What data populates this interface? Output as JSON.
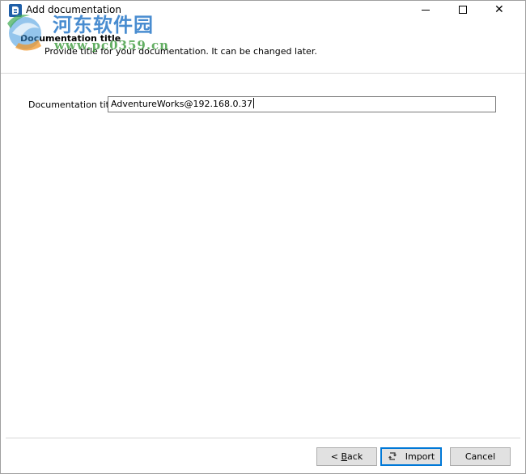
{
  "window": {
    "title": "Add documentation"
  },
  "watermark": {
    "chinese": "河东软件园",
    "url": "www.pc0359.cn"
  },
  "header": {
    "title": "Documentation title",
    "description": "Provide title for your documentation. It can be changed later."
  },
  "form": {
    "title_label": "Documentation title",
    "title_value": "AdventureWorks@192.168.0.37"
  },
  "buttons": {
    "back_prefix": "< ",
    "back_mnemonic": "B",
    "back_rest": "ack",
    "import": "Import",
    "cancel": "Cancel"
  },
  "colors": {
    "accent": "#0078d7",
    "button_face": "#e1e1e1",
    "border": "#adadad"
  }
}
